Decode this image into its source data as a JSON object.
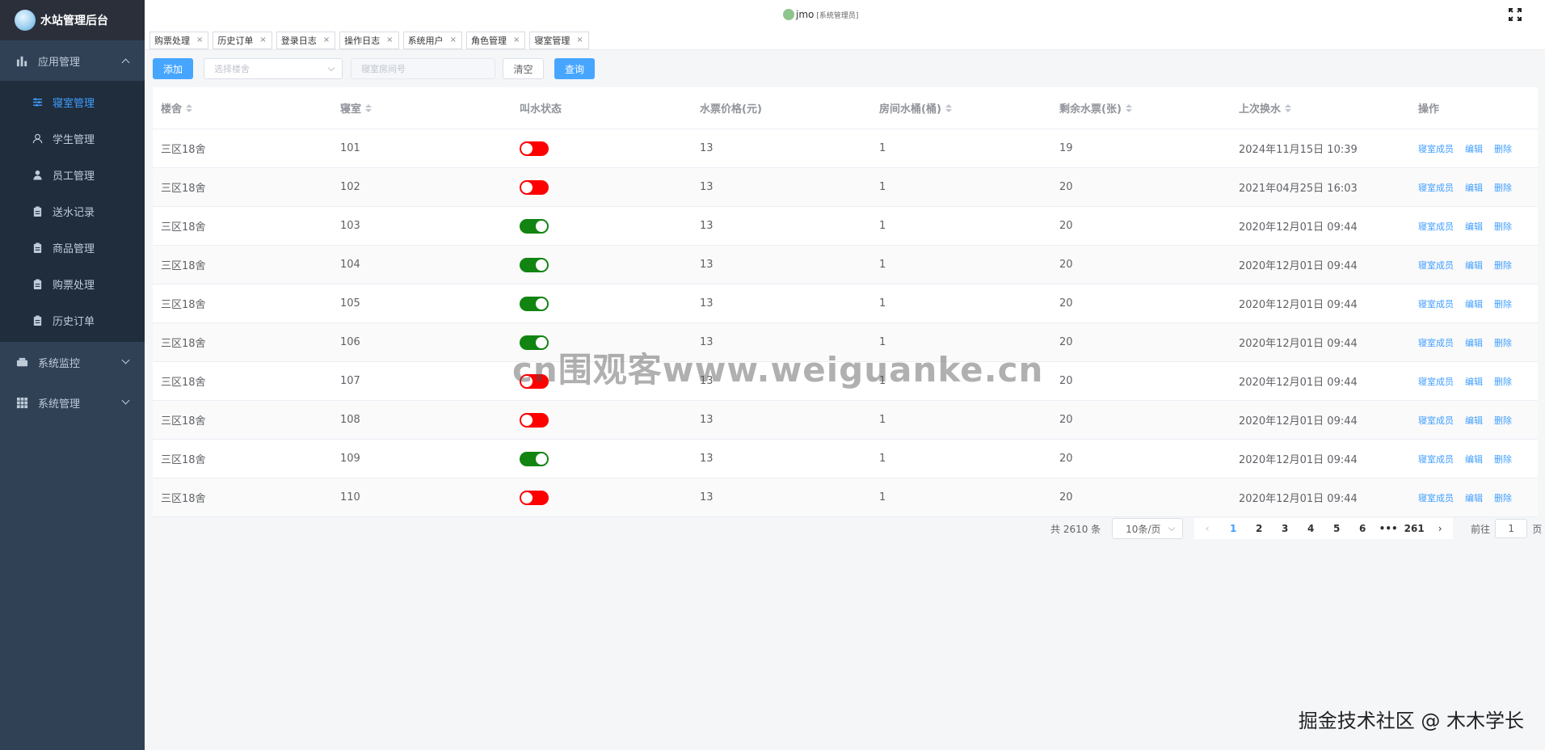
{
  "app": {
    "title": "水站管理后台"
  },
  "sidebar": {
    "groups": [
      {
        "label": "应用管理",
        "expanded": true
      },
      {
        "label": "系统监控",
        "expanded": false
      },
      {
        "label": "系统管理",
        "expanded": false
      }
    ],
    "items": [
      {
        "label": "寝室管理",
        "icon": "sliders-icon",
        "active": true
      },
      {
        "label": "学生管理",
        "icon": "user-outline-icon"
      },
      {
        "label": "员工管理",
        "icon": "user-filled-icon"
      },
      {
        "label": "送水记录",
        "icon": "clipboard-icon"
      },
      {
        "label": "商品管理",
        "icon": "clipboard-icon"
      },
      {
        "label": "购票处理",
        "icon": "clipboard-icon"
      },
      {
        "label": "历史订单",
        "icon": "clipboard-icon"
      }
    ]
  },
  "header": {
    "username": "jmo",
    "role": "[系统管理员]"
  },
  "tags": [
    "购票处理",
    "历史订单",
    "登录日志",
    "操作日志",
    "系统用户",
    "角色管理",
    "寝室管理"
  ],
  "toolbar": {
    "add_label": "添加",
    "building_placeholder": "选择楼舍",
    "room_placeholder": "寝室房间号",
    "clear_label": "清空",
    "query_label": "查询"
  },
  "table": {
    "columns": [
      "楼舍",
      "寝室",
      "叫水状态",
      "水票价格(元)",
      "房间水桶(桶)",
      "剩余水票(张)",
      "上次换水",
      "操作"
    ],
    "actions": [
      "寝室成员",
      "编辑",
      "删除"
    ],
    "rows": [
      {
        "building": "三区18舍",
        "room": "101",
        "status": false,
        "price": "13",
        "buckets": "1",
        "tickets": "19",
        "last": "2024年11月15日 10:39"
      },
      {
        "building": "三区18舍",
        "room": "102",
        "status": false,
        "price": "13",
        "buckets": "1",
        "tickets": "20",
        "last": "2021年04月25日 16:03"
      },
      {
        "building": "三区18舍",
        "room": "103",
        "status": true,
        "price": "13",
        "buckets": "1",
        "tickets": "20",
        "last": "2020年12月01日 09:44"
      },
      {
        "building": "三区18舍",
        "room": "104",
        "status": true,
        "price": "13",
        "buckets": "1",
        "tickets": "20",
        "last": "2020年12月01日 09:44"
      },
      {
        "building": "三区18舍",
        "room": "105",
        "status": true,
        "price": "13",
        "buckets": "1",
        "tickets": "20",
        "last": "2020年12月01日 09:44"
      },
      {
        "building": "三区18舍",
        "room": "106",
        "status": true,
        "price": "13",
        "buckets": "1",
        "tickets": "20",
        "last": "2020年12月01日 09:44"
      },
      {
        "building": "三区18舍",
        "room": "107",
        "status": false,
        "price": "13",
        "buckets": "1",
        "tickets": "20",
        "last": "2020年12月01日 09:44"
      },
      {
        "building": "三区18舍",
        "room": "108",
        "status": false,
        "price": "13",
        "buckets": "1",
        "tickets": "20",
        "last": "2020年12月01日 09:44"
      },
      {
        "building": "三区18舍",
        "room": "109",
        "status": true,
        "price": "13",
        "buckets": "1",
        "tickets": "20",
        "last": "2020年12月01日 09:44"
      },
      {
        "building": "三区18舍",
        "room": "110",
        "status": false,
        "price": "13",
        "buckets": "1",
        "tickets": "20",
        "last": "2020年12月01日 09:44"
      }
    ]
  },
  "pagination": {
    "total_label": "共 2610 条",
    "page_size": "10条/页",
    "pages": [
      "1",
      "2",
      "3",
      "4",
      "5",
      "6",
      "•••",
      "261"
    ],
    "current": "1",
    "goto_prefix": "前往",
    "goto_value": "1",
    "goto_suffix": "页"
  },
  "watermarks": {
    "center": "cn围观客www.weiguanke.cn",
    "corner": "掘金技术社区 @ 木木学长"
  },
  "colors": {
    "sidebar": "#304156",
    "sidebar_sub": "#1f2d3d",
    "accent": "#409eff",
    "switch_on": "#118411",
    "switch_off": "#ff0000"
  }
}
